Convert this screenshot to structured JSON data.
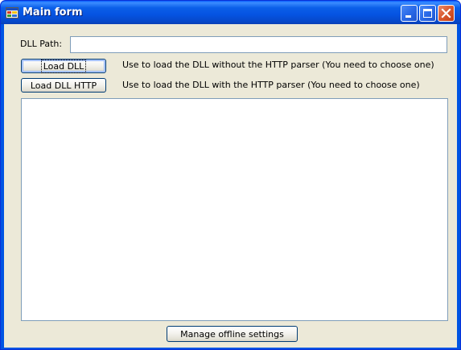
{
  "window": {
    "title": "Main form",
    "colors": {
      "titlebar": "#0554e3",
      "client": "#ece9d8",
      "close_button": "#d9582e"
    }
  },
  "titlebar_buttons": {
    "minimize_icon": "minimize-icon",
    "maximize_icon": "maximize-icon",
    "close_icon": "close-icon"
  },
  "form": {
    "dll_path_label": "DLL Path:",
    "dll_path_value": "",
    "load_dll_button": "Load DLL",
    "load_dll_description": "Use to load the DLL without the HTTP parser (You need to choose one)",
    "load_dll_http_button": "Load DLL HTTP",
    "load_dll_http_description": "Use to load the DLL with the HTTP parser (You need to choose one)",
    "output_list_items": [],
    "manage_offline_button": "Manage offline settings"
  }
}
